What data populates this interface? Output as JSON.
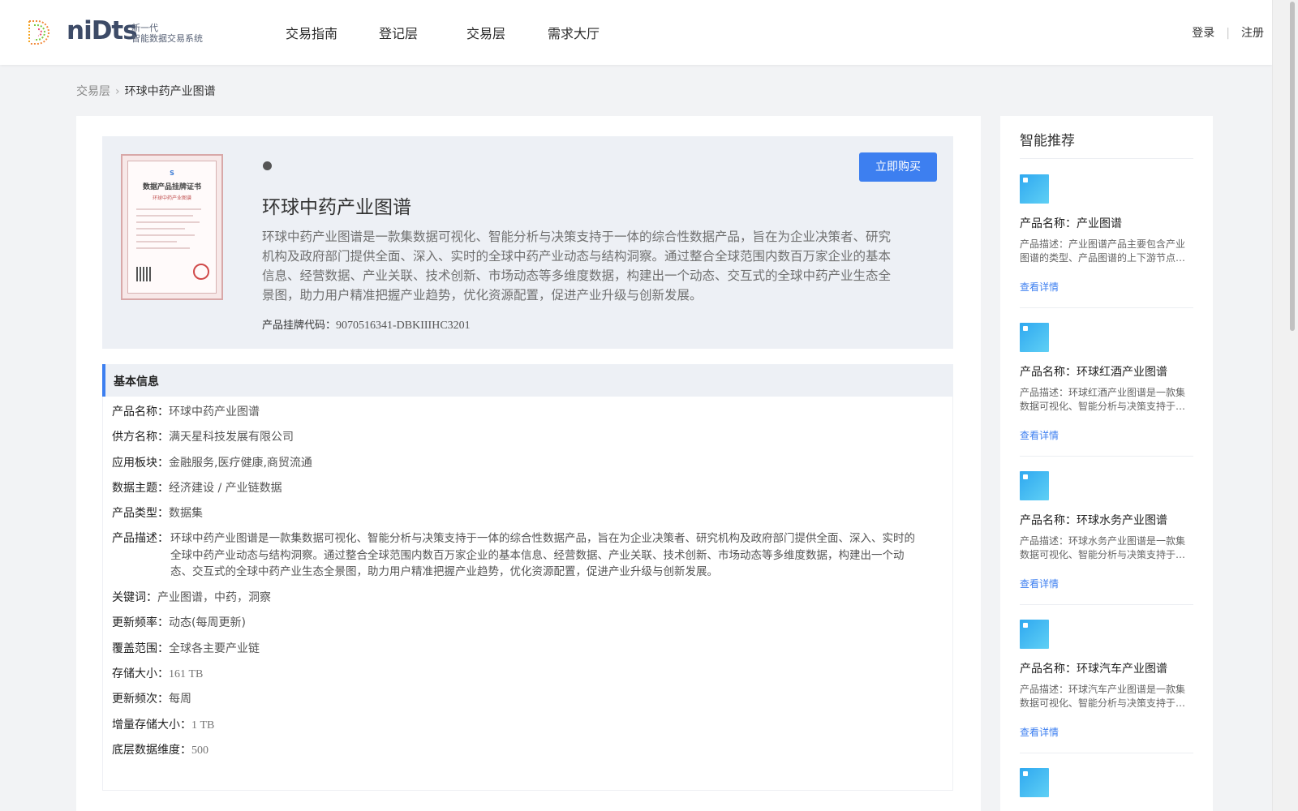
{
  "header": {
    "logo_word": "niDts",
    "logo_sub_1": "新一代",
    "logo_sub_2": "智能数据交易系统",
    "nav": [
      "交易指南",
      "登记层",
      "交易层",
      "需求大厅"
    ],
    "login": "登录",
    "register": "注册"
  },
  "breadcrumb": {
    "parent": "交易层",
    "current": "环球中药产业图谱"
  },
  "product": {
    "title": "环球中药产业图谱",
    "description": "环球中药产业图谱是一款集数据可视化、智能分析与决策支持于一体的综合性数据产品，旨在为企业决策者、研究机构及政府部门提供全面、深入、实时的全球中药产业动态与结构洞察。通过整合全球范围内数百万家企业的基本信息、经营数据、产业关联、技术创新、市场动态等多维度数据，构建出一个动态、交互式的全球中药产业生态全景图，助力用户精准把握产业趋势，优化资源配置，促进产业升级与创新发展。",
    "code_label": "产品挂牌代码：",
    "code_value": "9070516341-DBKIIIHC3201",
    "buy_label": "立即购买",
    "certificate_title": "数据产品挂牌证书",
    "certificate_sub": "环球中药产业图谱"
  },
  "basic_info": {
    "section_title": "基本信息",
    "rows": [
      {
        "label": "产品名称：",
        "value": "环球中药产业图谱"
      },
      {
        "label": "供方名称：",
        "value": "满天星科技发展有限公司"
      },
      {
        "label": "应用板块：",
        "value": "金融服务,医疗健康,商贸流通"
      },
      {
        "label": "数据主题：",
        "value": "经济建设 / 产业链数据"
      },
      {
        "label": "产品类型：",
        "value": "数据集"
      }
    ],
    "desc_label": "产品描述：",
    "desc_value": "环球中药产业图谱是一款集数据可视化、智能分析与决策支持于一体的综合性数据产品，旨在为企业决策者、研究机构及政府部门提供全面、深入、实时的全球中药产业动态与结构洞察。通过整合全球范围内数百万家企业的基本信息、经营数据、产业关联、技术创新、市场动态等多维度数据，构建出一个动态、交互式的全球中药产业生态全景图，助力用户精准把握产业趋势，优化资源配置，促进产业升级与创新发展。",
    "rows2": [
      {
        "label": "关键词：",
        "value": "产业图谱，中药，洞察"
      },
      {
        "label": "更新频率：",
        "value": "动态(每周更新)"
      },
      {
        "label": "覆盖范围：",
        "value": "全球各主要产业链"
      },
      {
        "label": "存储大小：",
        "value": "161 TB"
      },
      {
        "label": "更新频次：",
        "value": "每周"
      },
      {
        "label": "增量存储大小：",
        "value": "1 TB"
      },
      {
        "label": "底层数据维度：",
        "value": "500"
      }
    ]
  },
  "recommend": {
    "title": "智能推荐",
    "link_label": "查看详情",
    "items": [
      {
        "name": "产品名称：产业图谱",
        "desc": "产品描述：产业图谱产品主要包含产业图谱的类型、产品图谱的上下游节点…"
      },
      {
        "name": "产品名称：环球红酒产业图谱",
        "desc": "产品描述：环球红酒产业图谱是一款集数据可视化、智能分析与决策支持于…"
      },
      {
        "name": "产品名称：环球水务产业图谱",
        "desc": "产品描述：环球水务产业图谱是一款集数据可视化、智能分析与决策支持于…"
      },
      {
        "name": "产品名称：环球汽车产业图谱",
        "desc": "产品描述：环球汽车产业图谱是一款集数据可视化、智能分析与决策支持于…"
      }
    ]
  },
  "colors": {
    "accent": "#3d7ff0",
    "hero_bg": "#edf0f5",
    "page_bg": "#f2f3f5"
  }
}
